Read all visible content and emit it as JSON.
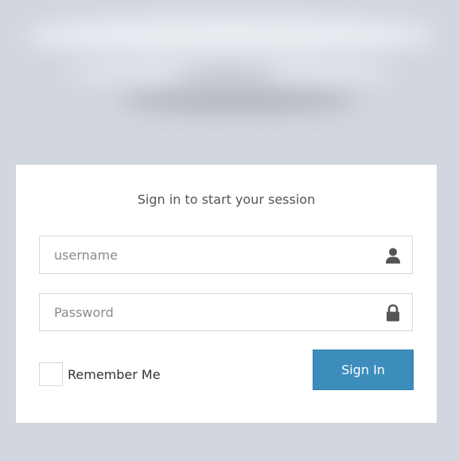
{
  "login": {
    "message": "Sign in to start your session",
    "username": {
      "placeholder": "username",
      "value": "",
      "icon": "user-icon"
    },
    "password": {
      "placeholder": "Password",
      "value": "",
      "icon": "lock-icon"
    },
    "remember_label": "Remember Me",
    "remember_checked": false,
    "signin_label": "Sign In"
  },
  "colors": {
    "page_background": "#d2d6de",
    "box_background": "#ffffff",
    "primary_button": "#3c8dbc",
    "field_border": "#d2d6de",
    "icon": "#555555"
  }
}
